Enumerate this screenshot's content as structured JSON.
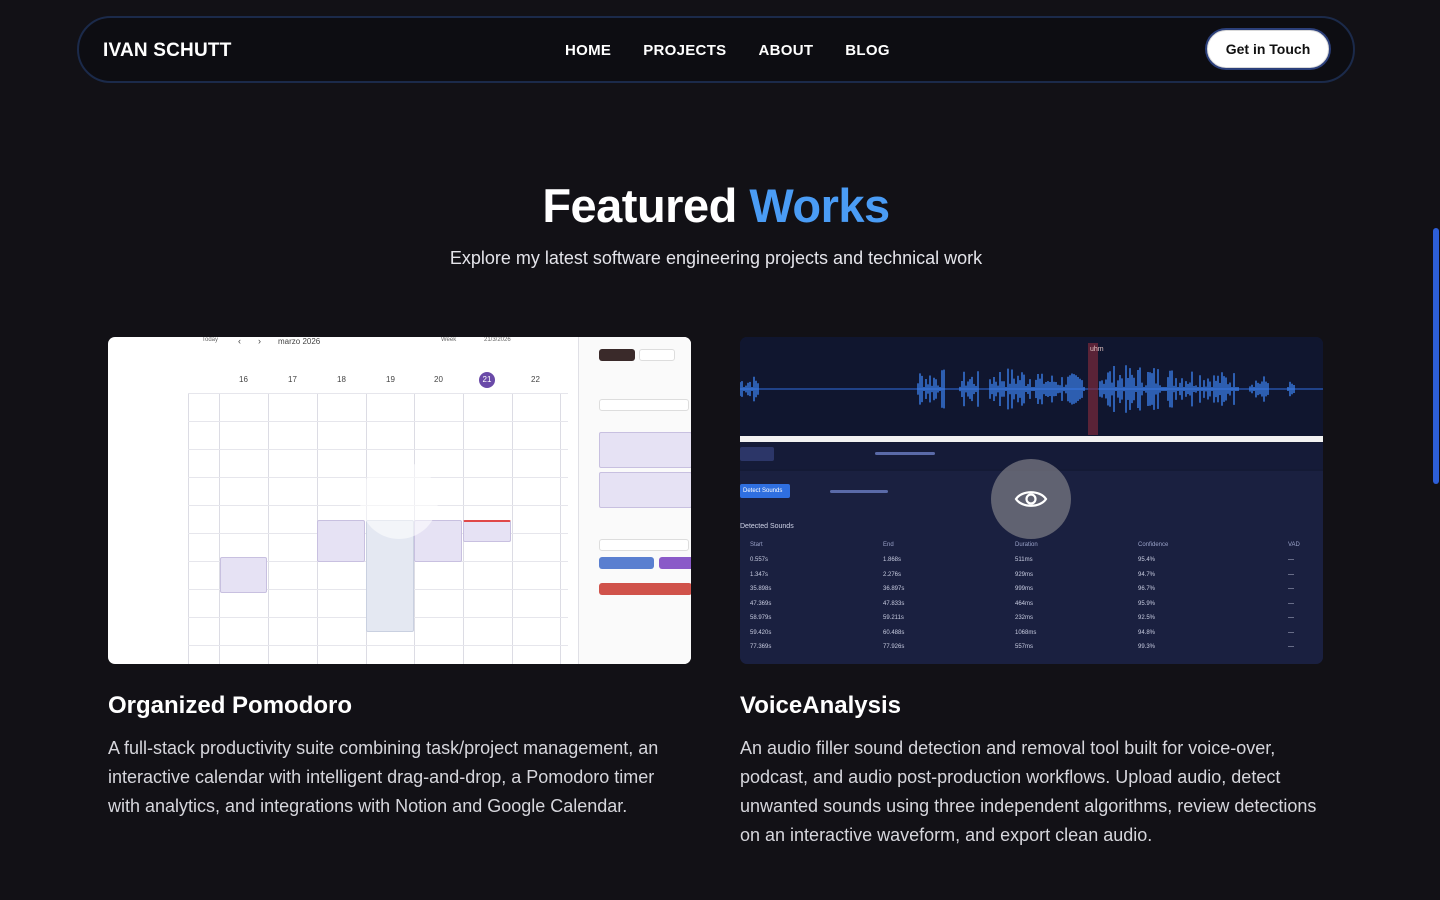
{
  "nav": {
    "brand": "IVAN SCHUTT",
    "links": [
      "HOME",
      "PROJECTS",
      "ABOUT",
      "BLOG"
    ],
    "cta": "Get in Touch"
  },
  "section": {
    "title_part1": "Featured",
    "title_part2": "Works",
    "subtitle": "Explore my latest software engineering projects and technical work"
  },
  "projects": [
    {
      "title": "Organized Pomodoro",
      "description": "A full-stack productivity suite combining task/project management, an interactive calendar with intelligent drag-and-drop, a Pomodoro timer with analytics, and integrations with Notion and Google Calendar.",
      "preview": {
        "month": "marzo 2026",
        "view": "Week",
        "date": "21/3/2026",
        "days": [
          "16",
          "17",
          "18",
          "19",
          "20",
          "21",
          "22"
        ],
        "today": "21"
      }
    },
    {
      "title": "VoiceAnalysis",
      "description": "An audio filler sound detection and removal tool built for voice-over, podcast, and audio post-production workflows. Upload audio, detect unwanted sounds using three independent algorithms, review detections on an interactive waveform, and export clean audio.",
      "preview": {
        "marker": "uhm",
        "detect_button": "Detect Sounds",
        "table_title": "Detected Sounds",
        "columns": [
          "Start",
          "End",
          "Duration",
          "Confidence",
          "VAD"
        ],
        "rows": [
          [
            "0.557s",
            "1.868s",
            "511ms",
            "95.4%",
            "—"
          ],
          [
            "1.347s",
            "2.276s",
            "929ms",
            "94.7%",
            "—"
          ],
          [
            "35.898s",
            "36.897s",
            "999ms",
            "96.7%",
            "—"
          ],
          [
            "47.369s",
            "47.833s",
            "464ms",
            "95.9%",
            "—"
          ],
          [
            "58.979s",
            "59.211s",
            "232ms",
            "92.5%",
            "—"
          ],
          [
            "59.420s",
            "60.488s",
            "1068ms",
            "94.8%",
            "—"
          ],
          [
            "77.369s",
            "77.926s",
            "557ms",
            "99.3%",
            "—"
          ]
        ]
      }
    }
  ],
  "colors": {
    "background": "#121116",
    "accent": "#4a9cf5",
    "nav_border": "#1b2a4a"
  }
}
